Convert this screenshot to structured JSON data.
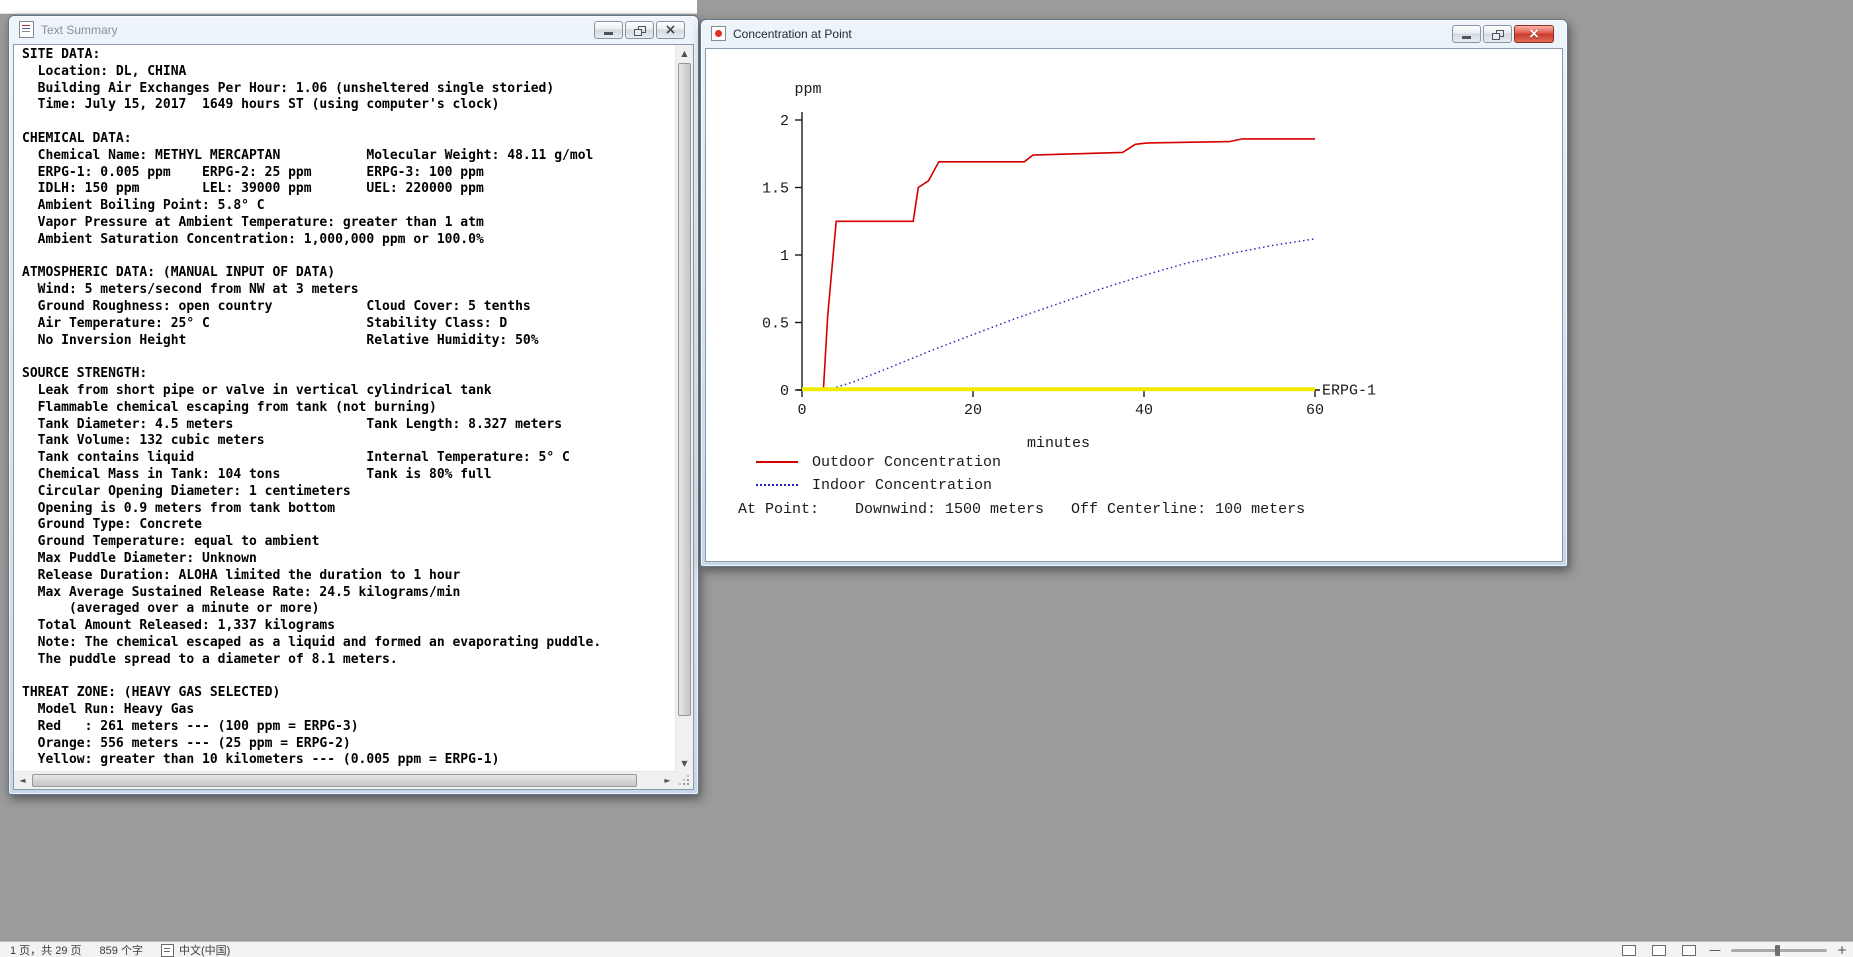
{
  "desktop": {
    "background_color": "#9b9b9b"
  },
  "icons": {
    "scroll_up": "▲",
    "scroll_down": "▼",
    "scroll_left": "◄",
    "scroll_right": "►",
    "close": "×"
  },
  "text_summary_window": {
    "title": "Text Summary",
    "lines": [
      "SITE DATA:",
      "  Location: DL, CHINA",
      "  Building Air Exchanges Per Hour: 1.06 (unsheltered single storied)",
      "  Time: July 15, 2017  1649 hours ST (using computer's clock)",
      "",
      "CHEMICAL DATA:",
      "  Chemical Name: METHYL MERCAPTAN           Molecular Weight: 48.11 g/mol",
      "  ERPG-1: 0.005 ppm    ERPG-2: 25 ppm       ERPG-3: 100 ppm",
      "  IDLH: 150 ppm        LEL: 39000 ppm       UEL: 220000 ppm",
      "  Ambient Boiling Point: 5.8° C",
      "  Vapor Pressure at Ambient Temperature: greater than 1 atm",
      "  Ambient Saturation Concentration: 1,000,000 ppm or 100.0%",
      "",
      "ATMOSPHERIC DATA: (MANUAL INPUT OF DATA)",
      "  Wind: 5 meters/second from NW at 3 meters",
      "  Ground Roughness: open country            Cloud Cover: 5 tenths",
      "  Air Temperature: 25° C                    Stability Class: D",
      "  No Inversion Height                       Relative Humidity: 50%",
      "",
      "SOURCE STRENGTH:",
      "  Leak from short pipe or valve in vertical cylindrical tank",
      "  Flammable chemical escaping from tank (not burning)",
      "  Tank Diameter: 4.5 meters                 Tank Length: 8.327 meters",
      "  Tank Volume: 132 cubic meters",
      "  Tank contains liquid                      Internal Temperature: 5° C",
      "  Chemical Mass in Tank: 104 tons           Tank is 80% full",
      "  Circular Opening Diameter: 1 centimeters",
      "  Opening is 0.9 meters from tank bottom",
      "  Ground Type: Concrete",
      "  Ground Temperature: equal to ambient",
      "  Max Puddle Diameter: Unknown",
      "  Release Duration: ALOHA limited the duration to 1 hour",
      "  Max Average Sustained Release Rate: 24.5 kilograms/min",
      "      (averaged over a minute or more)",
      "  Total Amount Released: 1,337 kilograms",
      "  Note: The chemical escaped as a liquid and formed an evaporating puddle.",
      "  The puddle spread to a diameter of 8.1 meters.",
      "",
      "THREAT ZONE: (HEAVY GAS SELECTED)",
      "  Model Run: Heavy Gas",
      "  Red   : 261 meters --- (100 ppm = ERPG-3)",
      "  Orange: 556 meters --- (25 ppm = ERPG-2)",
      "  Yellow: greater than 10 kilometers --- (0.005 ppm = ERPG-1)"
    ]
  },
  "chart_window": {
    "title": "Concentration at Point",
    "legend": {
      "outdoor": "Outdoor Concentration",
      "indoor": "Indoor Concentration"
    },
    "at_point": "At Point:    Downwind: 1500 meters   Off Centerline: 100 meters"
  },
  "chart_data": {
    "type": "line",
    "title": "Concentration at Point",
    "xlabel": "minutes",
    "ylabel": "ppm",
    "xlim": [
      0,
      60
    ],
    "ylim": [
      0,
      2
    ],
    "xticks": [
      0,
      20,
      40,
      60
    ],
    "yticks": [
      0,
      0.5,
      1,
      1.5,
      2
    ],
    "grid": false,
    "legend_position": "below-left",
    "series": [
      {
        "name": "Outdoor Concentration",
        "color": "#d40000",
        "style": "solid",
        "width": 1.6,
        "points": [
          [
            0,
            0
          ],
          [
            2.5,
            0
          ],
          [
            3,
            0.55
          ],
          [
            4,
            1.25
          ],
          [
            13,
            1.25
          ],
          [
            13.6,
            1.5
          ],
          [
            14.8,
            1.55
          ],
          [
            16,
            1.69
          ],
          [
            26,
            1.69
          ],
          [
            27,
            1.74
          ],
          [
            37.5,
            1.76
          ],
          [
            39,
            1.82
          ],
          [
            40.5,
            1.83
          ],
          [
            50,
            1.84
          ],
          [
            51.5,
            1.86
          ],
          [
            60,
            1.86
          ]
        ]
      },
      {
        "name": "Indoor Concentration",
        "color": "#2121bb",
        "style": "dotted",
        "width": 1.4,
        "points": [
          [
            3,
            0
          ],
          [
            6,
            0.06
          ],
          [
            10,
            0.16
          ],
          [
            15,
            0.29
          ],
          [
            20,
            0.41
          ],
          [
            25,
            0.53
          ],
          [
            30,
            0.64
          ],
          [
            35,
            0.75
          ],
          [
            40,
            0.85
          ],
          [
            45,
            0.94
          ],
          [
            50,
            1.01
          ],
          [
            55,
            1.07
          ],
          [
            60,
            1.12
          ]
        ]
      },
      {
        "name": "ERPG-1",
        "color": "#f0ec00",
        "style": "solid",
        "width": 4,
        "points": [
          [
            0,
            0.005
          ],
          [
            60,
            0.005
          ]
        ],
        "right_label": "ERPG-1"
      }
    ]
  },
  "status_bar": {
    "page_info": "1 页，共 29 页",
    "word_count": "859 个字",
    "language": "中文(中国)",
    "zoom_out_glyph": "—",
    "zoom_in_glyph": "+"
  }
}
